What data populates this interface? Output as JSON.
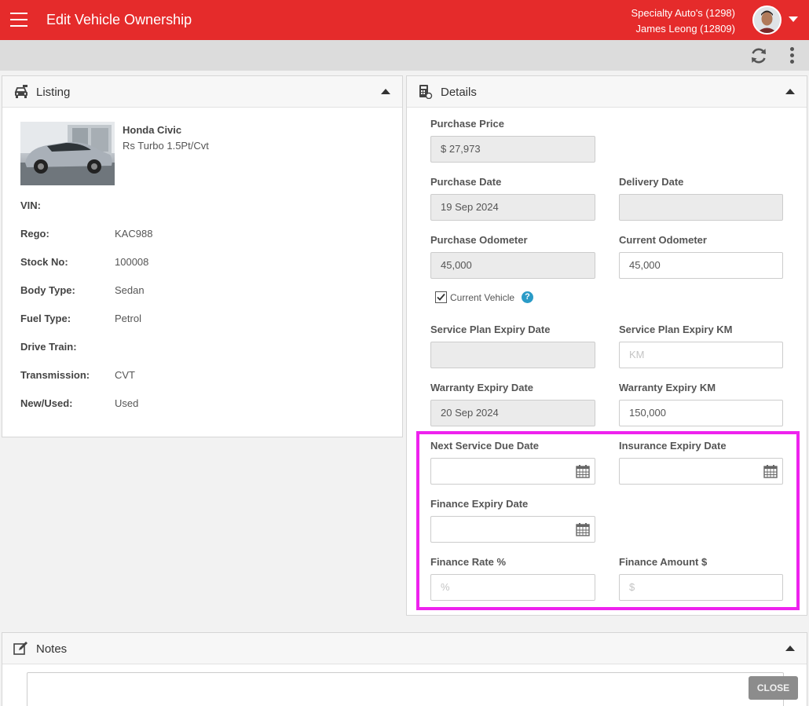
{
  "header": {
    "title": "Edit Vehicle Ownership",
    "dealer": "Specialty Auto's (1298)",
    "user": "James Leong (12809)"
  },
  "listing": {
    "title": "Listing",
    "car_name": "Honda Civic",
    "car_variant": "Rs Turbo 1.5Pt/Cvt",
    "specs": [
      {
        "label": "VIN:",
        "value": ""
      },
      {
        "label": "Rego:",
        "value": "KAC988"
      },
      {
        "label": "Stock No:",
        "value": "100008"
      },
      {
        "label": "Body Type:",
        "value": "Sedan"
      },
      {
        "label": "Fuel Type:",
        "value": "Petrol"
      },
      {
        "label": "Drive Train:",
        "value": ""
      },
      {
        "label": "Transmission:",
        "value": "CVT"
      },
      {
        "label": "New/Used:",
        "value": "Used"
      }
    ]
  },
  "details": {
    "title": "Details",
    "purchase_price": {
      "label": "Purchase Price",
      "value": "$ 27,973"
    },
    "purchase_date": {
      "label": "Purchase Date",
      "value": "19 Sep 2024"
    },
    "delivery_date": {
      "label": "Delivery Date",
      "value": ""
    },
    "purchase_odometer": {
      "label": "Purchase Odometer",
      "value": "45,000"
    },
    "current_odometer": {
      "label": "Current Odometer",
      "value": "45,000"
    },
    "current_vehicle": {
      "label": "Current Vehicle",
      "checked": true
    },
    "service_plan_expiry_date": {
      "label": "Service Plan Expiry Date",
      "value": ""
    },
    "service_plan_expiry_km": {
      "label": "Service Plan Expiry KM",
      "placeholder": "KM"
    },
    "warranty_expiry_date": {
      "label": "Warranty Expiry Date",
      "value": "20 Sep 2024"
    },
    "warranty_expiry_km": {
      "label": "Warranty Expiry KM",
      "value": "150,000"
    },
    "next_service_due_date": {
      "label": "Next Service Due Date",
      "value": ""
    },
    "insurance_expiry_date": {
      "label": "Insurance Expiry Date",
      "value": ""
    },
    "finance_expiry_date": {
      "label": "Finance Expiry Date",
      "value": ""
    },
    "finance_rate": {
      "label": "Finance Rate %",
      "placeholder": "%"
    },
    "finance_amount": {
      "label": "Finance Amount $",
      "placeholder": "$"
    }
  },
  "notes": {
    "title": "Notes"
  },
  "close_label": "CLOSE",
  "colors": {
    "appbar": "#e52b2b",
    "highlight": "#ee22ee",
    "help": "#2a9bc7"
  }
}
